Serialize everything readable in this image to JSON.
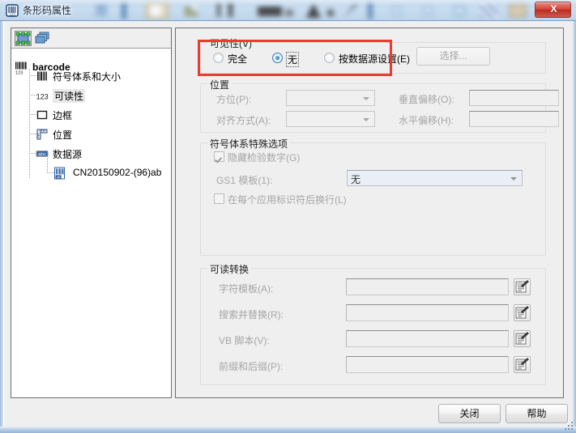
{
  "window": {
    "title": "条形码属性",
    "title_icon": "barcode-icon",
    "close_label": "X"
  },
  "sidebar": {
    "toolbar": [
      {
        "name": "select-object-icon",
        "tooltip": ""
      },
      {
        "name": "layers-icon",
        "tooltip": ""
      }
    ],
    "tree": {
      "root": {
        "label": "barcode",
        "icon": "barcode-123-icon"
      },
      "children": [
        {
          "label": "符号体系和大小",
          "icon": "barcode-bars-icon",
          "selected": false
        },
        {
          "label": "可读性",
          "icon": "digits-123-icon",
          "selected": true
        },
        {
          "label": "边框",
          "icon": "square-outline-icon",
          "selected": false
        },
        {
          "label": "位置",
          "icon": "ruler-icon",
          "selected": false
        },
        {
          "label": "数据源",
          "icon": "abc-badge-icon",
          "selected": false
        }
      ],
      "grandchild": {
        "label": "CN20150902-(96)ab",
        "icon": "barcode-data-icon"
      }
    }
  },
  "main": {
    "visibility": {
      "title": "可见性(V)",
      "options": [
        {
          "label": "完全",
          "selected": false
        },
        {
          "label": "无",
          "selected": true,
          "focused": true
        },
        {
          "label": "按数据源设置(E)",
          "selected": false
        }
      ],
      "select_button": {
        "label": "选择...",
        "disabled": true
      },
      "highlight_color": "#ef3b2e"
    },
    "position": {
      "title": "位置",
      "fields": [
        {
          "label": "方位(P):",
          "type": "combo",
          "value": "",
          "disabled": true
        },
        {
          "label": "垂直偏移(O):",
          "type": "text",
          "value": "",
          "placeholder": "",
          "disabled": true
        },
        {
          "label": "对齐方式(A):",
          "type": "combo",
          "value": "",
          "disabled": true
        },
        {
          "label": "水平偏移(H):",
          "type": "text",
          "value": "",
          "placeholder": "",
          "disabled": true
        }
      ]
    },
    "symbology": {
      "title": "符号体系特殊选项",
      "hide_check_digit": {
        "label": "隐藏检验数字(G)",
        "checked": true,
        "disabled": true
      },
      "gs1_template": {
        "label": "GS1 模板(1):",
        "value": "无",
        "disabled": true
      },
      "newline_after_ai": {
        "label": "在每个应用标识符后换行(L)",
        "checked": false,
        "disabled": true
      }
    },
    "readable_conversion": {
      "title": "可读转换",
      "rows": [
        {
          "label": "字符模板(A):",
          "value": "",
          "disabled": true,
          "button_icon": "edit-template-icon"
        },
        {
          "label": "搜索并替换(R):",
          "value": "",
          "disabled": true,
          "button_icon": "edit-template-icon"
        },
        {
          "label": "VB 脚本(V):",
          "value": "",
          "disabled": true,
          "button_icon": "edit-template-icon"
        },
        {
          "label": "前缀和后缀(P):",
          "value": "",
          "disabled": true,
          "button_icon": "edit-template-icon"
        }
      ]
    }
  },
  "footer": {
    "close_label": "关闭",
    "help_label": "帮助"
  }
}
